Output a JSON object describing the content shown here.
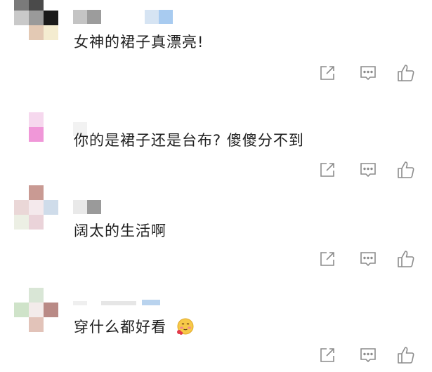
{
  "comments": [
    {
      "text": "女神的裙子真漂亮!",
      "emoji": null
    },
    {
      "text": "你的是裙子还是台布? 傻傻分不到",
      "emoji": null
    },
    {
      "text": "阔太的生活啊",
      "emoji": null
    },
    {
      "text": "穿什么都好看",
      "emoji": "blushing-face-emoji"
    }
  ],
  "actions": {
    "share_icon": "share-icon",
    "comment_icon": "comment-icon",
    "like_icon": "thumbs-up-icon",
    "icon_color": "#8c8c8c"
  },
  "colors": {
    "text": "#1f1f1f",
    "background": "#ffffff"
  }
}
